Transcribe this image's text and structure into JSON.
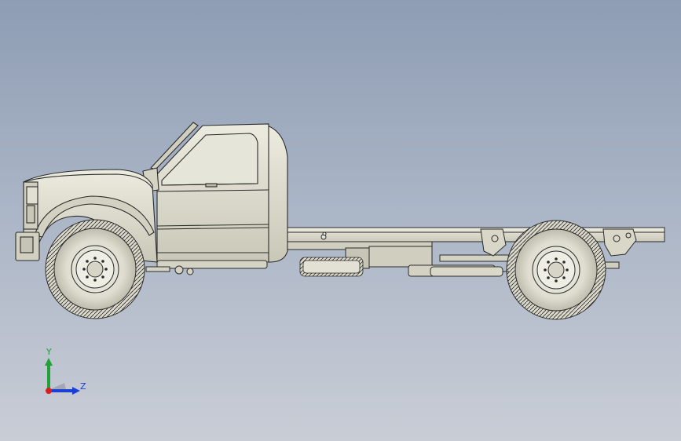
{
  "viewport": {
    "background_top": "#8e9db4",
    "background_bottom": "#c9cdd6"
  },
  "model": {
    "name": "truck-chassis-cab",
    "body_color": "#d6d6c7",
    "outline_color": "#2b2b2b"
  },
  "triad": {
    "y_label": "Y",
    "z_label": "Z",
    "y_color": "#22a03a",
    "z_color": "#1b3fd6",
    "x_color": "#d62020"
  }
}
